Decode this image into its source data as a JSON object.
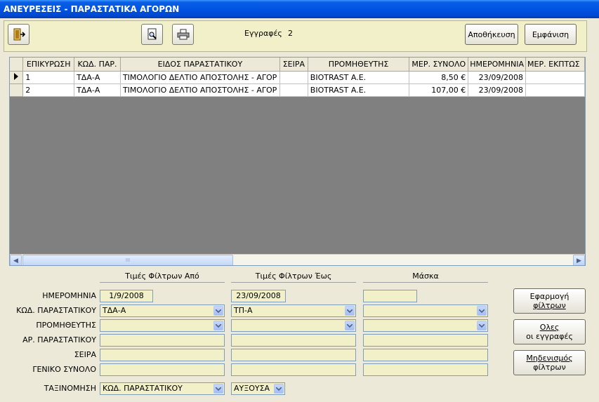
{
  "window": {
    "title": "ΑΝΕΥΡΕΣΕΙΣ - ΠΑΡΑΣΤΑΤΙΚΑ ΑΓΟΡΩΝ"
  },
  "toolbar": {
    "exit_icon": "exit-door-icon",
    "preview_icon": "print-preview-icon",
    "print_icon": "printer-icon",
    "records_label": "Εγγραφές",
    "records_count": "2",
    "save_label": "Αποθήκευση",
    "show_label": "Εμφάνιση"
  },
  "grid": {
    "columns": [
      "ΕΠΙΚΥΡΩΣΗ",
      "ΚΩΔ. ΠΑΡ.",
      "ΕΙΔΟΣ ΠΑΡΑΣΤΑΤΙΚΟΥ",
      "ΣΕΙΡΑ",
      "ΠΡΟΜΗΘΕΥΤΗΣ",
      "ΜΕΡ. ΣΥΝΟΛΟ",
      "ΗΜΕΡΟΜΗΝΙΑ",
      "ΜΕΡ. ΕΚΠΤΩΣ"
    ],
    "rows": [
      [
        "1",
        "ΤΔΑ-Α",
        "ΤΙΜΟΛΟΓΙΟ ΔΕΛΤΙΟ ΑΠΟΣΤΟΛΗΣ - ΑΓΟΡ",
        "",
        "BIOTRAST A.E.",
        "8,50 €",
        "23/09/2008",
        ""
      ],
      [
        "2",
        "ΤΔΑ-Α",
        "ΤΙΜΟΛΟΓΙΟ ΔΕΛΤΙΟ ΑΠΟΣΤΟΛΗΣ - ΑΓΟΡ",
        "",
        "BIOTRAST A.E.",
        "107,00 €",
        "23/09/2008",
        ""
      ]
    ],
    "scroll_thumb_grip": "III"
  },
  "filters": {
    "headers": {
      "from": "Τιμές Φίλτρων Από",
      "to": "Τιμές Φίλτρων Έως",
      "mask": "Μάσκα"
    },
    "rows": [
      {
        "label": "ΗΜΕΡΟΜΗΝΙΑ",
        "from": "1/9/2008",
        "to": "23/09/2008",
        "mask": ""
      },
      {
        "label": "ΚΩΔ. ΠΑΡΑΣΤΑΤΙΚΟΥ",
        "from": "ΤΔΑ-Α",
        "to": "ΤΠ-Α",
        "mask": ""
      },
      {
        "label": "ΠΡΟΜΗΘΕΥΤΗΣ",
        "from": "",
        "to": "",
        "mask": ""
      },
      {
        "label": "ΑΡ. ΠΑΡΑΣΤΑΤΙΚΟΥ",
        "from": "",
        "to": "",
        "mask": ""
      },
      {
        "label": "ΣΕΙΡΑ",
        "from": "",
        "to": "",
        "mask": ""
      },
      {
        "label": "ΓΕΝΙΚΟ ΣΥΝΟΛΟ",
        "from": "",
        "to": "",
        "mask": ""
      }
    ],
    "sort": {
      "label": "ΤΑΞΙΝΟΜΗΣΗ",
      "field": "ΚΩΔ. ΠΑΡΑΣΤΑΤΙΚΟΥ",
      "order": "ΑΥΞΟΥΣΑ"
    }
  },
  "actions": {
    "apply": [
      "Εφαρμογή",
      "φίλτρων"
    ],
    "all": [
      "Ολες",
      "οι εγγραφές"
    ],
    "reset": [
      "Μηδενισμός",
      "φίλτρων"
    ]
  },
  "colors": {
    "titlebar": "#0054E3",
    "form_bg": "#ECE9D8",
    "field_bg": "#F1F0C8",
    "grid_empty": "#808080"
  }
}
